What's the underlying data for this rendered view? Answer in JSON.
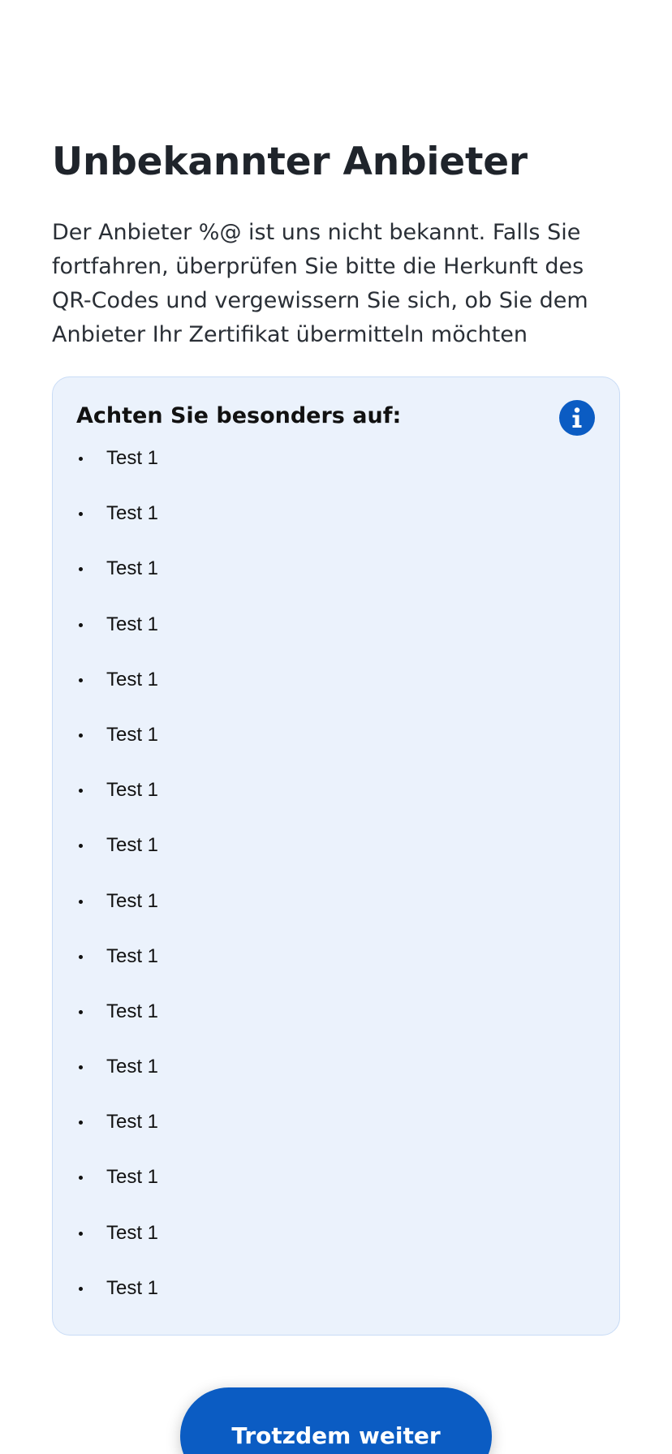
{
  "screen": {
    "title": "Unbekannter Anbieter",
    "description": "Der Anbieter %@ ist uns nicht bekannt. Falls Sie fortfahren, überprüfen Sie bitte die Herkunft des QR-Codes und vergewissern Sie sich, ob Sie dem Anbieter Ihr Zertifikat übermitteln möchten"
  },
  "info_box": {
    "heading": "Achten Sie besonders auf:",
    "icon": "info-icon",
    "items": [
      {
        "label": "Test 1"
      },
      {
        "label": "Test 1"
      },
      {
        "label": "Test 1"
      },
      {
        "label": "Test 1"
      },
      {
        "label": "Test 1"
      },
      {
        "label": "Test 1"
      },
      {
        "label": "Test 1"
      },
      {
        "label": "Test 1"
      },
      {
        "label": "Test 1"
      },
      {
        "label": "Test 1"
      },
      {
        "label": "Test 1"
      },
      {
        "label": "Test 1"
      },
      {
        "label": "Test 1"
      },
      {
        "label": "Test 1"
      },
      {
        "label": "Test 1"
      },
      {
        "label": "Test 1"
      }
    ]
  },
  "actions": {
    "continue_label": "Trotzdem weiter"
  },
  "colors": {
    "primary": "#0B5CC3",
    "info_background": "#EBF2FC",
    "info_border": "#C9DCF6",
    "text_dark": "#1F242B"
  }
}
